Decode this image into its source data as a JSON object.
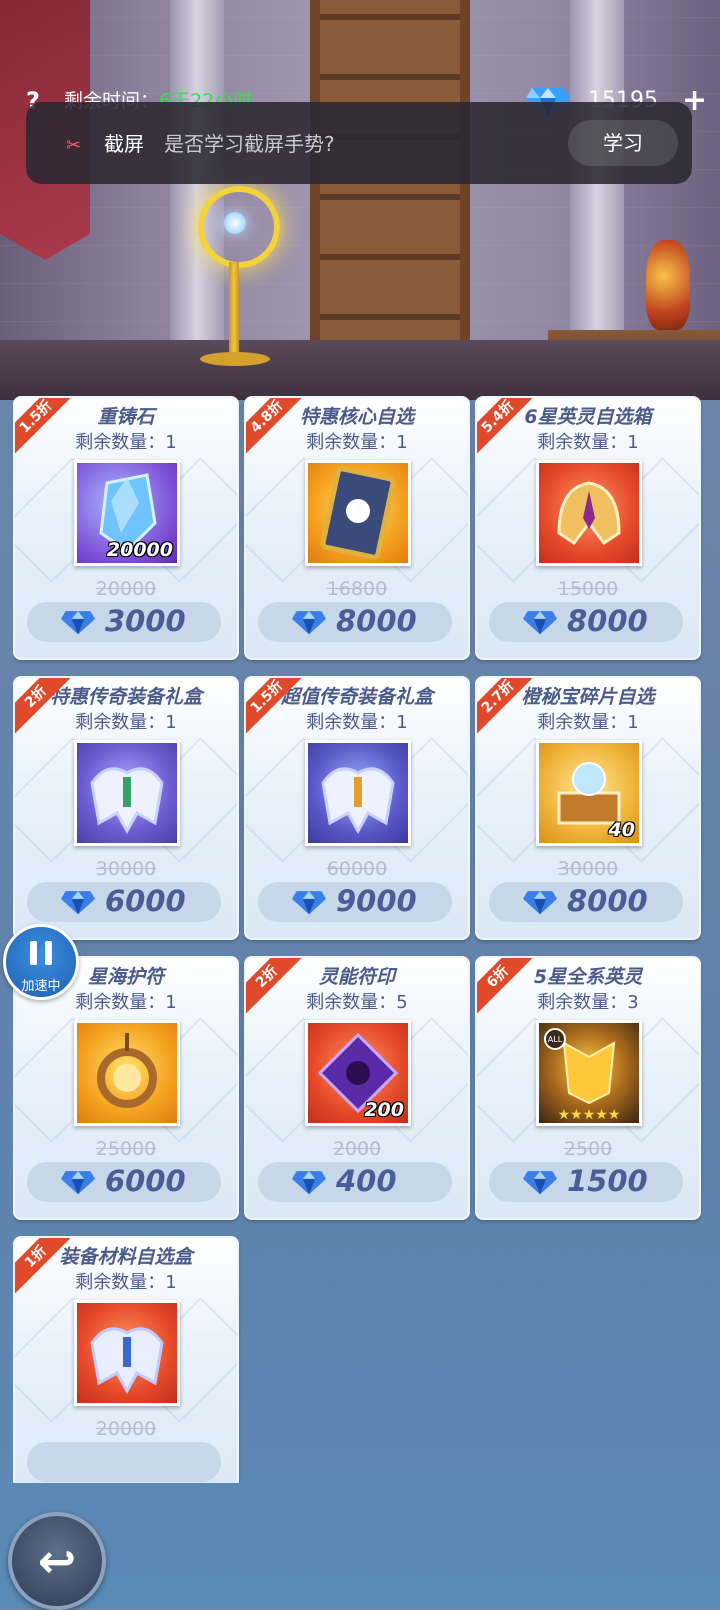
{
  "header": {
    "help_icon": "?",
    "time_label": "剩余时间：",
    "time_value": "6天22小时",
    "currency_amount": "15195",
    "plus_icon": "+"
  },
  "toast": {
    "icon": "scissors-icon",
    "title": "截屏",
    "text": "是否学习截屏手势?",
    "button": "学习"
  },
  "stock_label": "剩余数量：",
  "items": [
    {
      "badge": "1.5折",
      "name": "重铸石",
      "stock": "1",
      "qty": "20000",
      "old_price": "20000",
      "price": "3000",
      "art": "blue-crystal-stone"
    },
    {
      "badge": "4.8折",
      "name": "特惠核心自选",
      "stock": "1",
      "qty": "",
      "old_price": "16800",
      "price": "8000",
      "art": "core-card"
    },
    {
      "badge": "5.4折",
      "name": "6星英灵自选箱",
      "stock": "1",
      "qty": "",
      "old_price": "15000",
      "price": "8000",
      "art": "hero-helmet-box"
    },
    {
      "badge": "2折",
      "name": "特惠传奇装备礼盒",
      "stock": "1",
      "qty": "",
      "old_price": "30000",
      "price": "6000",
      "art": "legendary-armor"
    },
    {
      "badge": "1.5折",
      "name": "超值传奇装备礼盒",
      "stock": "1",
      "qty": "",
      "old_price": "60000",
      "price": "9000",
      "art": "legendary-armor"
    },
    {
      "badge": "2.7折",
      "name": "橙秘宝碎片自选",
      "stock": "1",
      "qty": "40",
      "old_price": "30000",
      "price": "8000",
      "art": "treasure-fragment"
    },
    {
      "badge": "",
      "name": "星海护符",
      "stock": "1",
      "qty": "",
      "old_price": "25000",
      "price": "6000",
      "art": "star-amulet"
    },
    {
      "badge": "2折",
      "name": "灵能符印",
      "stock": "5",
      "qty": "200",
      "old_price": "2000",
      "price": "400",
      "art": "psionic-sigil"
    },
    {
      "badge": "6折",
      "name": "5星全系英灵",
      "stock": "3",
      "qty": "",
      "old_price": "2500",
      "price": "1500",
      "art": "all-hero-mask"
    },
    {
      "badge": "1折",
      "name": "装备材料自选盒",
      "stock": "1",
      "qty": "",
      "old_price": "20000",
      "price": "",
      "art": "equipment-material"
    }
  ],
  "speed_button": {
    "label": "加速中"
  },
  "back_button": {
    "icon": "back-arrow-icon"
  },
  "colors": {
    "discount_badge": "#e0492a",
    "price_text": "#4a5d98",
    "time_value": "#38e04a"
  }
}
